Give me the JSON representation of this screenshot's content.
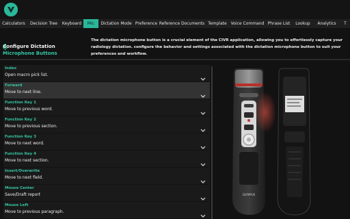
{
  "app": {
    "logo": "civr-logo-icon"
  },
  "tabs": [
    {
      "label": "Calculators",
      "active": false
    },
    {
      "label": "Decision Tree",
      "active": false
    },
    {
      "label": "Keyboard",
      "active": false
    },
    {
      "label": "Mic",
      "active": true
    },
    {
      "label": "Dictation Mode",
      "active": false
    },
    {
      "label": "Preference",
      "active": false
    },
    {
      "label": "Reference Documents",
      "active": false
    },
    {
      "label": "Template",
      "active": false
    },
    {
      "label": "Voice Command",
      "active": false
    },
    {
      "label": "Phrase List",
      "active": false
    },
    {
      "label": "Lookup",
      "active": false
    },
    {
      "label": "Analytics",
      "active": false
    },
    {
      "label": "T",
      "active": false
    }
  ],
  "header": {
    "title": "Configure Dictation",
    "subtitle": "Microphone Buttons",
    "icon": "microphone-icon",
    "description": "The dictation microphone button is a crucial element of the CIVR application, allowing you to effortlessly capture your radiology dictation. configure the behavior and settings associated with the dictation microphone button to suit your preferences and workflow."
  },
  "buttons": [
    {
      "label": "Index",
      "value": "Open macro pick list."
    },
    {
      "label": "Forward",
      "value": "Move to next line."
    },
    {
      "label": "Function Key 1",
      "value": "Move to previous word."
    },
    {
      "label": "Function Key 2",
      "value": "Move to previous section."
    },
    {
      "label": "Function Key 3",
      "value": "Move to next word."
    },
    {
      "label": "Function Key 4",
      "value": "Move to next section."
    },
    {
      "label": "Insert/Overwrite",
      "value": "Move to next field."
    },
    {
      "label": "Mouse Center",
      "value": "Save/Draft report"
    },
    {
      "label": "Mouse Left",
      "value": "Move to previous paragraph."
    }
  ],
  "device": {
    "brand": "OLYMPUS"
  },
  "colors": {
    "accent": "#2bb79a",
    "background": "#121212",
    "row": "#1a1a1a",
    "row_highlight": "#333333"
  }
}
